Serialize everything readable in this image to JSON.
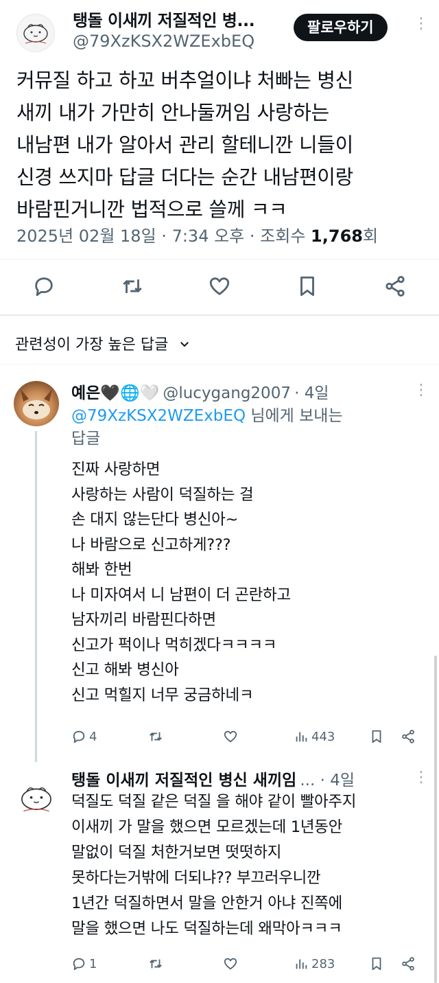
{
  "main_post": {
    "author_name": "탱돌 이새끼 저질적인 병...",
    "author_handle": "@79XzKSX2WZExbEQ",
    "follow_label": "팔로우하기",
    "body_lines": [
      "커뮤질 하고 하꼬 버추얼이냐 처빠는 병신",
      "새끼 내가 가만히 안나둘꺼임 사랑하는",
      "내남편 내가 알아서 관리 할테니깐 니들이",
      "신경 쓰지마 답글 더다는 순간 내남편이랑",
      "바람핀거니깐 법적으로 쓸께 ㅋㅋ"
    ],
    "date": "2025년 02월 18일",
    "time": "7:34 오후",
    "views_label": "조회수",
    "views_count": "1,768",
    "views_suffix": "회",
    "actions": [
      "reply-icon",
      "retweet-icon",
      "like-icon",
      "bookmark-icon",
      "share-icon"
    ]
  },
  "sort": {
    "label": "관련성이 가장 높은 답글"
  },
  "replies": [
    {
      "author_name": "예은🖤🌐🤍",
      "author_handle": "@lucygang2007",
      "time_ago": "4일",
      "reply_to_mention": "@79XzKSX2WZExbEQ",
      "reply_to_suffix": " 님에게 보내는",
      "reply_to_suffix2": "답글",
      "body_lines": [
        "진짜 사랑하면",
        "사랑하는 사람이 덕질하는 걸",
        "손 대지 않는단다 병신아~",
        "나 바람으로 신고하게???",
        "해봐 한번",
        "나 미자여서 니 남편이 더 곤란하고",
        "남자끼리 바람핀다하면",
        "신고가 퍽이나 먹히겠다ㅋㅋㅋㅋ",
        "신고 해봐 병신아",
        "신고 먹힐지 너무 궁금하네ㅋ"
      ],
      "reply_count": "4",
      "view_count": "443"
    },
    {
      "author_name": "탱돌 이새끼 저질적인 병신 새끼임",
      "time_ago": "4일",
      "body_lines": [
        "덕질도 덕질 같은 덕질 을 해야 같이 빨아주지",
        "이새끼 가 말을 했으면 모르겠는데 1년동안",
        "말없이 덕질 처한거보면 떳떳하지",
        "못하다는거밖에 더되냐?? 부끄러우니깐",
        "1년간 덕질하면서 말을 안한거 아냐 진쪽에",
        "말을 했으면 나도 덕질하는데 왜막아ㅋㅋㅋ"
      ],
      "reply_count": "1",
      "view_count": "283"
    }
  ],
  "colors": {
    "text": "#0f1419",
    "secondary": "#536471",
    "mention": "#1d9bf0",
    "follow_bg": "#0f1419"
  }
}
